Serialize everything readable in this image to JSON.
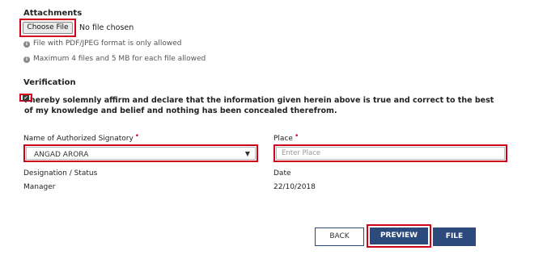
{
  "attachments": {
    "title": "Attachments",
    "choose_file_label": "Choose File",
    "file_status": "No file chosen",
    "info": [
      "File with PDF/JPEG format is only allowed",
      "Maximum 4 files and 5 MB for each file allowed"
    ]
  },
  "verification": {
    "title": "Verification",
    "checked": true,
    "declaration": "I hereby solemnly affirm and declare that the information given herein above is true and correct to the best of my knowledge and belief and nothing has been concealed therefrom."
  },
  "form": {
    "signatory": {
      "label": "Name of Authorized Signatory",
      "required_mark": "•",
      "value": "ANGAD ARORA"
    },
    "place": {
      "label": "Place",
      "required_mark": "•",
      "placeholder": "Enter Place",
      "value": ""
    },
    "designation": {
      "label": "Designation / Status",
      "value": "Manager"
    },
    "date": {
      "label": "Date",
      "value": "22/10/2018"
    }
  },
  "actions": {
    "back_label": "BACK",
    "preview_label": "PREVIEW",
    "file_label": "FILE"
  },
  "colors": {
    "primary": "#2c4a7c",
    "highlight": "#d0021b",
    "required": "#d0021b"
  },
  "icons": {
    "info": "info-circle-icon",
    "checkbox": "checkbox-checked-icon",
    "dropdown": "chevron-down-icon"
  }
}
